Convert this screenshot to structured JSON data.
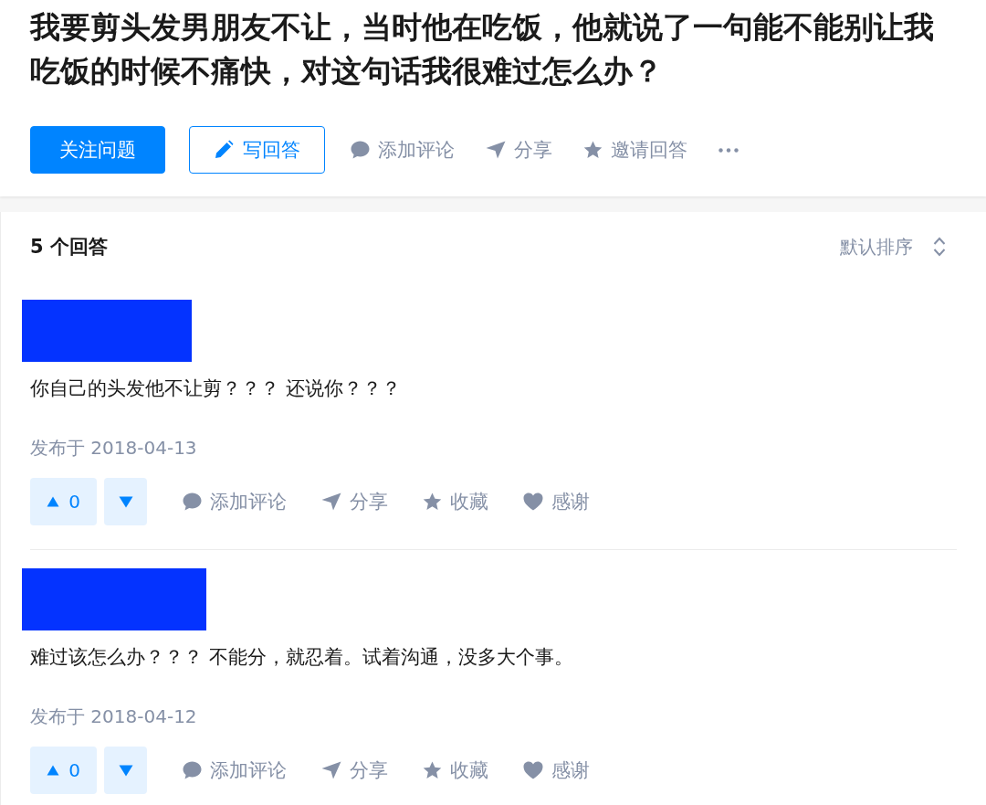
{
  "question": {
    "title": "我要剪头发男朋友不让，当时他在吃饭，他就说了一句能不能别让我吃饭的时候不痛快，对这句话我很难过怎么办？",
    "actions": [
      {
        "kind": "follow",
        "label": "关注问题"
      },
      {
        "kind": "write",
        "label": "写回答"
      },
      {
        "kind": "comment",
        "label": "添加评论"
      },
      {
        "kind": "share",
        "label": "分享"
      },
      {
        "kind": "invite",
        "label": "邀请回答"
      },
      {
        "kind": "more"
      }
    ]
  },
  "answers_header": {
    "count_label": "5 个回答",
    "sort_label": "默认排序"
  },
  "answers": [
    {
      "content": "你自己的头发他不让剪？？？ 还说你？？？",
      "published": "发布于 2018-04-13",
      "votes": "0",
      "actions": [
        {
          "kind": "comment",
          "label": "添加评论"
        },
        {
          "kind": "share",
          "label": "分享"
        },
        {
          "kind": "collect",
          "label": "收藏"
        },
        {
          "kind": "thank",
          "label": "感谢"
        }
      ]
    },
    {
      "content": "难过该怎么办？？？ 不能分，就忍着。试着沟通，没多大个事。",
      "published": "发布于 2018-04-12",
      "votes": "0",
      "actions": [
        {
          "kind": "comment",
          "label": "添加评论"
        },
        {
          "kind": "share",
          "label": "分享"
        },
        {
          "kind": "collect",
          "label": "收藏"
        },
        {
          "kind": "thank",
          "label": "感谢"
        }
      ]
    }
  ]
}
